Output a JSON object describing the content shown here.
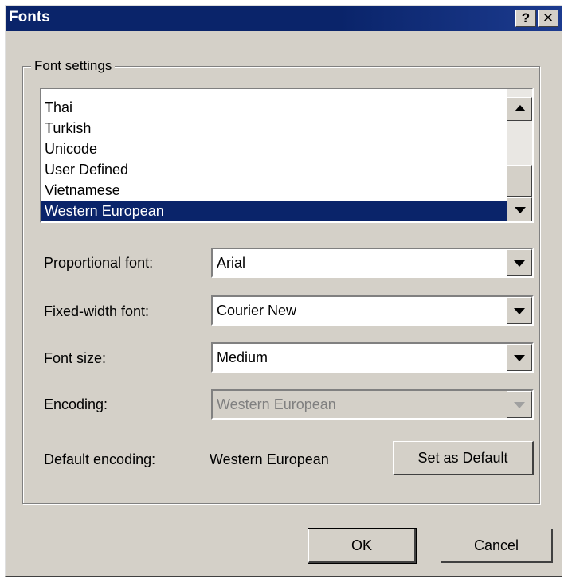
{
  "window": {
    "title": "Fonts",
    "help_label": "?",
    "close_label": "✕"
  },
  "group": {
    "legend": "Font settings"
  },
  "charset_list": {
    "items": [
      "Thai",
      "Turkish",
      "Unicode",
      "User Defined",
      "Vietnamese",
      "Western European"
    ],
    "selected": "Western European"
  },
  "fields": {
    "proportional": {
      "label": "Proportional font:",
      "value": "Arial"
    },
    "fixed": {
      "label": "Fixed-width font:",
      "value": "Courier New"
    },
    "size": {
      "label": "Font size:",
      "value": "Medium"
    },
    "encoding": {
      "label": "Encoding:",
      "value": "Western European",
      "disabled": true
    }
  },
  "default_encoding": {
    "label": "Default encoding:",
    "value": "Western European",
    "button": "Set as Default"
  },
  "buttons": {
    "ok": "OK",
    "cancel": "Cancel"
  },
  "colors": {
    "titlebar": "#0a246a",
    "face": "#d4d0c8",
    "selection": "#0a246a"
  }
}
